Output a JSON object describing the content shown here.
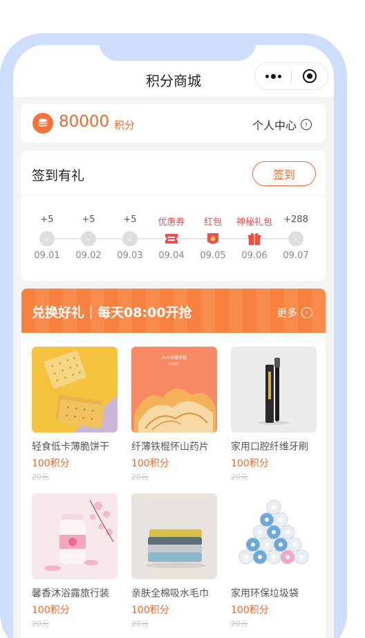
{
  "nav": {
    "title": "积分商城",
    "more_icon": "more-dots-icon",
    "close_icon": "record-circle-icon"
  },
  "points": {
    "value": "80000",
    "unit": "积分",
    "personal_center": "个人中心",
    "coin_icon": "coin-stack-icon"
  },
  "signin": {
    "title": "签到有礼",
    "button": "签到",
    "days": [
      {
        "reward": "+5",
        "date": "09.01",
        "kind": "points"
      },
      {
        "reward": "+5",
        "date": "09.02",
        "kind": "points"
      },
      {
        "reward": "+5",
        "date": "09.03",
        "kind": "points"
      },
      {
        "reward": "优惠券",
        "date": "09.04",
        "kind": "coupon"
      },
      {
        "reward": "红包",
        "date": "09.05",
        "kind": "redpacket"
      },
      {
        "reward": "神秘礼包",
        "date": "09.06",
        "kind": "gift"
      },
      {
        "reward": "+288",
        "date": "09.07",
        "kind": "points"
      }
    ]
  },
  "exchange": {
    "title": "兑换好礼｜每天08:00开抢",
    "more": "更多",
    "products": [
      {
        "name": "轻食低卡薄脆饼干",
        "price": "100积分",
        "original": "20元"
      },
      {
        "name": "纤薄铁棍怀山药片",
        "price": "100积分",
        "original": "20元",
        "pack_text": "片片纤薄铁棍",
        "pack_sub": "怀山药片"
      },
      {
        "name": "家用口腔纤维牙刷",
        "price": "100积分",
        "original": "20元"
      },
      {
        "name": "馨香沐浴露旅行装",
        "price": "100积分",
        "original": "20元"
      },
      {
        "name": "亲肤全棉吸水毛巾",
        "price": "100积分",
        "original": "20元"
      },
      {
        "name": "家用环保垃圾袋",
        "price": "100积分",
        "original": "20元"
      }
    ]
  },
  "colors": {
    "accent": "#f06a2d",
    "frame": "#cfddfd",
    "hot": "#ec4d4d"
  }
}
